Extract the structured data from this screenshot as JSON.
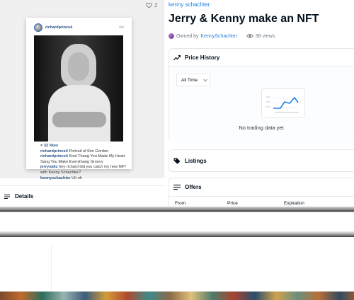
{
  "media": {
    "favorite_count": "2",
    "post": {
      "username": "richardprince4",
      "time": "4m",
      "likes": "32 likes",
      "caption_lines": [
        {
          "user": "richardprince4",
          "text": "Portrait of Kim Gordon"
        },
        {
          "user": "richardprince4",
          "text": "Kool Thang You Made My Heart Sang You Make Everythang Groovy"
        },
        {
          "user": "jerrysaltz",
          "text": "hey richard did you catch my new NFT with Kenny Schachter?"
        },
        {
          "user": "kennyschachter",
          "text": "Uh oh"
        }
      ]
    }
  },
  "details": {
    "label": "Details"
  },
  "asset": {
    "collection": "kenny schachter",
    "title": "Jerry & Kenny make an NFT",
    "owned_by_label": "Owned by",
    "owner": "KennySchachter",
    "views": "38 views"
  },
  "price_history": {
    "label": "Price History",
    "range": "All Time",
    "empty_text": "No trading data yet"
  },
  "listings": {
    "label": "Listings"
  },
  "offers": {
    "label": "Offers",
    "columns": [
      "From",
      "Price",
      "Expiration"
    ]
  },
  "colors": {
    "accent": "#2081e2",
    "text": "#04111d",
    "muted": "#707a83",
    "border": "#e5e8eb"
  }
}
